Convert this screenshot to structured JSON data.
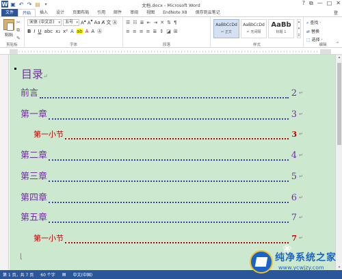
{
  "app": {
    "window_title": "文档.docx - Microsoft Word",
    "controls": [
      "?",
      "⧉",
      "—",
      "□",
      "✕"
    ],
    "quick_access": [
      "word-icon",
      "save-icon",
      "undo-icon",
      "redo-icon",
      "open-icon",
      "dropdown-icon"
    ]
  },
  "tabs": [
    {
      "label": "文件"
    },
    {
      "label": "开始"
    },
    {
      "label": "插入"
    },
    {
      "label": "设计"
    },
    {
      "label": "页面布局"
    },
    {
      "label": "引用"
    },
    {
      "label": "邮件"
    },
    {
      "label": "审阅"
    },
    {
      "label": "视图"
    },
    {
      "label": "EndNote X8"
    },
    {
      "label": "保存到云笔记"
    }
  ],
  "signin_label": "登",
  "ribbon": {
    "clipboard": {
      "paste": "粘贴",
      "group": "剪贴板"
    },
    "font": {
      "family": "宋体 (中文正)",
      "size": "五号",
      "group": "字体"
    },
    "paragraph": {
      "group": "段落"
    },
    "styles": {
      "group": "样式",
      "items": [
        {
          "sample": "AaBbCcDd",
          "name": "↵ 正文"
        },
        {
          "sample": "AaBbCcDd",
          "name": "↵ 无间隔"
        },
        {
          "sample": "AaBb",
          "name": "标题 1"
        }
      ]
    },
    "editing": {
      "group": "编辑",
      "find": "查找 ·",
      "replace": "替换",
      "select": "选择 ·"
    }
  },
  "document": {
    "title": "目录",
    "pilcrow": "↵",
    "entries": [
      {
        "text": "前言",
        "page": "2",
        "level": 1
      },
      {
        "text": "第一章",
        "page": "3",
        "level": 1
      },
      {
        "text": "第一小节",
        "page": "3",
        "level": 2
      },
      {
        "text": "第二章",
        "page": "4",
        "level": 1
      },
      {
        "text": "第三章",
        "page": "5",
        "level": 1
      },
      {
        "text": "第四章",
        "page": "6",
        "level": 1
      },
      {
        "text": "第五章",
        "page": "7",
        "level": 1
      },
      {
        "text": "第一小节",
        "page": "7",
        "level": 2
      }
    ]
  },
  "status": {
    "page": "第 1 页，共 7 页",
    "words": "60 个字",
    "lang": "中文(中国)"
  },
  "watermark": {
    "title": "纯净系统之家",
    "url": "www.ycwjzy.com"
  },
  "colors": {
    "accent": "#2b579a",
    "doc_bg": "#cce8cf",
    "toc_purple": "#7030a0",
    "toc_red": "#c00000"
  }
}
